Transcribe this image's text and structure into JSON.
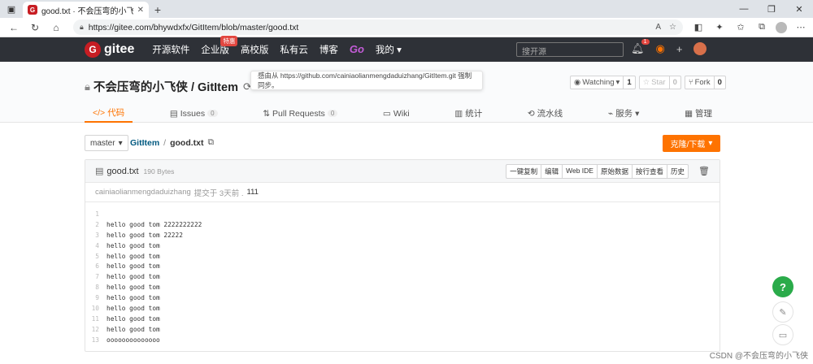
{
  "browser": {
    "tab_title": "good.txt · 不会压弯的小飞侠/Git",
    "favicon": "G",
    "url": "https://gitee.com/bhywdxfx/GitItem/blob/master/good.txt"
  },
  "gitee_nav": {
    "logo": "gitee",
    "items": [
      "开源软件",
      "企业版",
      "高校版",
      "私有云",
      "博客",
      "Go",
      "我的"
    ],
    "badge": "特惠",
    "search_placeholder": "搜开源",
    "notification_count": "1"
  },
  "repo": {
    "owner_repo": "不会压弯的小飞侠 / GitItem",
    "sync_tooltip": "感由从 https://github.com/cainiaolianmengdaduizhang/GitItem.git 强制同步。",
    "watching_label": "Watching",
    "watching_count": "1",
    "star_label": "Star",
    "star_count": "0",
    "fork_label": "Fork",
    "fork_count": "0",
    "tabs": [
      {
        "label": "代码",
        "count": ""
      },
      {
        "label": "Issues",
        "count": "0"
      },
      {
        "label": "Pull Requests",
        "count": "0"
      },
      {
        "label": "Wiki",
        "count": ""
      },
      {
        "label": "统计",
        "count": ""
      },
      {
        "label": "流水线",
        "count": ""
      },
      {
        "label": "服务",
        "count": ""
      },
      {
        "label": "管理",
        "count": ""
      }
    ]
  },
  "file": {
    "branch": "master",
    "crumb_repo": "GitItem",
    "crumb_file": "good.txt",
    "clone_label": "克隆/下载",
    "name": "good.txt",
    "size": "190 Bytes",
    "buttons": [
      "一键复制",
      "编辑",
      "Web IDE",
      "原始数据",
      "按行查看",
      "历史"
    ],
    "commit_author": "cainiaolianmengdaduizhang",
    "commit_info": "提交于 3天前 .",
    "commit_msg": "111",
    "lines": [
      "",
      "hello good tom 2222222222",
      "hello good tom 22222",
      "hello good tom",
      "hello good tom",
      "hello good tom",
      "hello good tom",
      "hello good tom",
      "hello good tom",
      "hello good tom",
      "hello good tom",
      "hello good tom",
      "oooooooooooooo"
    ]
  },
  "watermark": "CSDN @不会压弯的小飞侠"
}
